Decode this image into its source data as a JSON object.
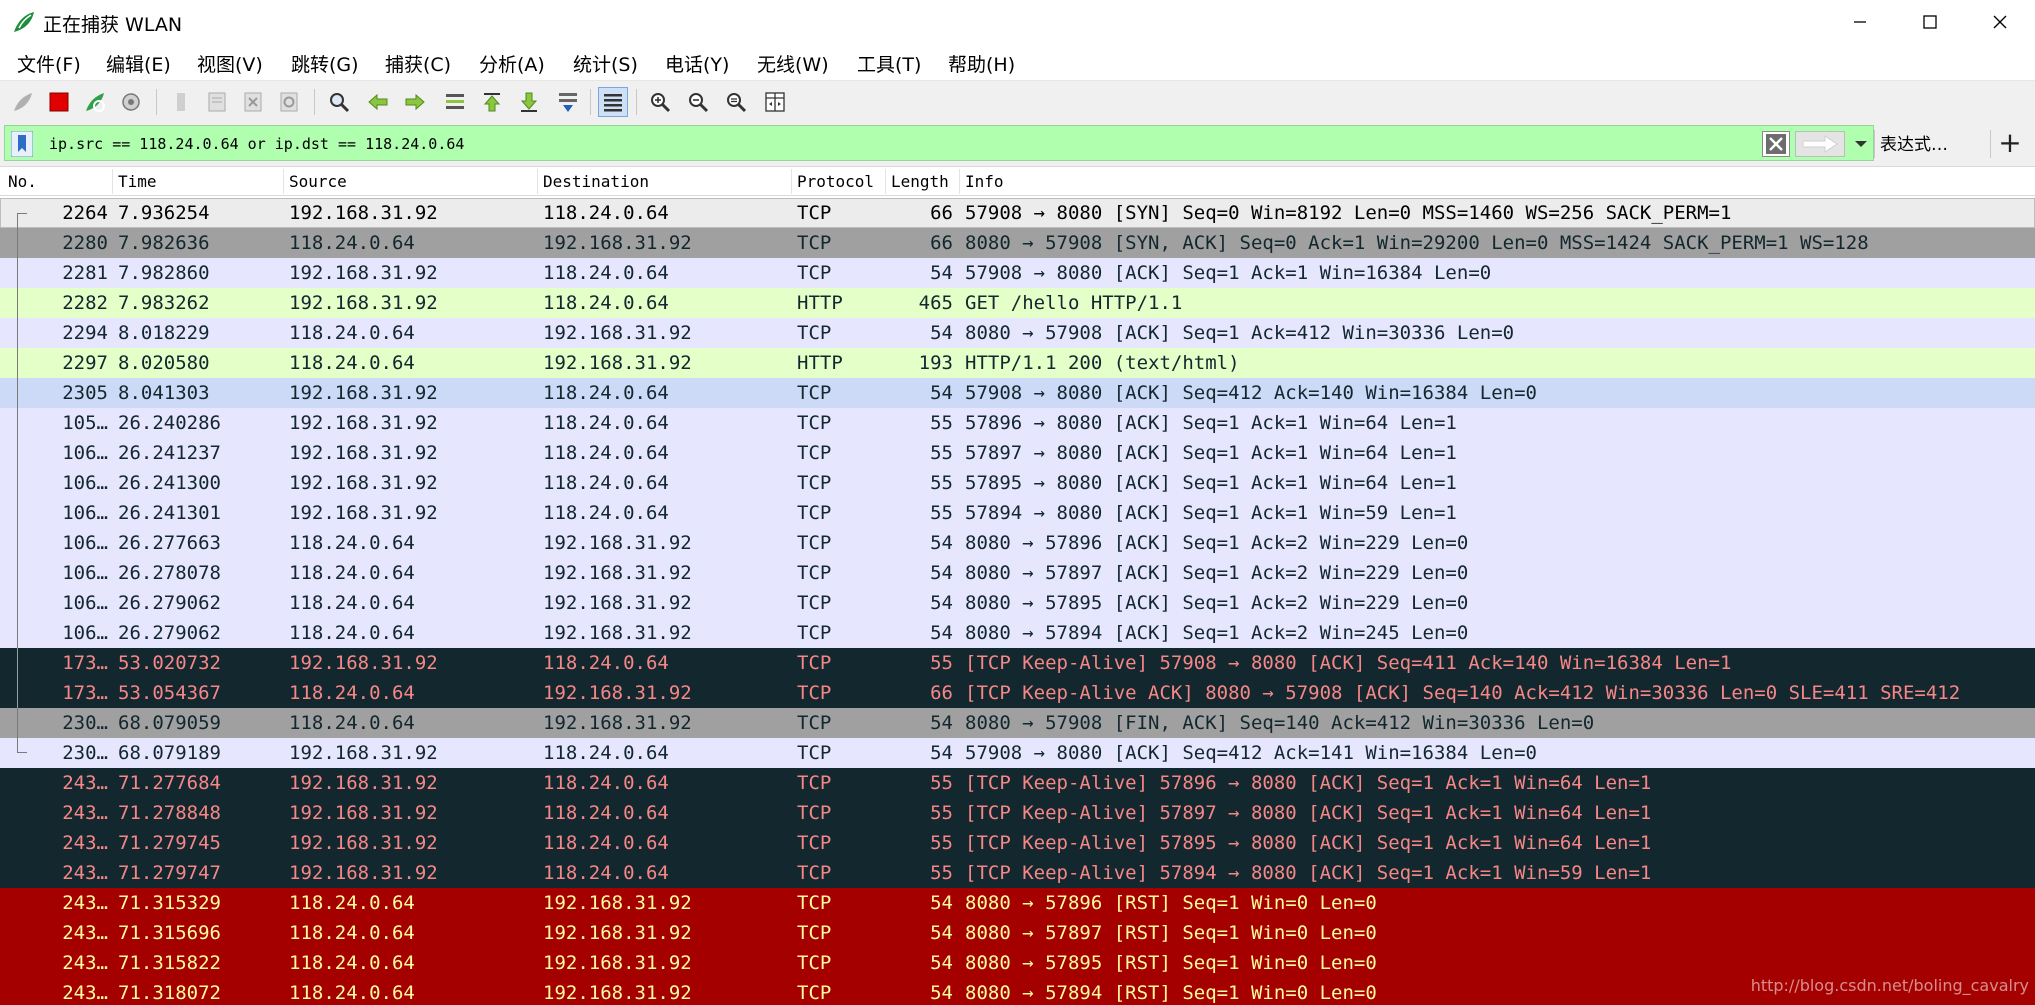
{
  "window": {
    "title": "正在捕获 WLAN",
    "minimize": "—",
    "maximize": "☐",
    "close": "✕"
  },
  "menu": [
    "文件(F)",
    "编辑(E)",
    "视图(V)",
    "跳转(G)",
    "捕获(C)",
    "分析(A)",
    "统计(S)",
    "电话(Y)",
    "无线(W)",
    "工具(T)",
    "帮助(H)"
  ],
  "filter": {
    "value": "ip.src == 118.24.0.64 or ip.dst == 118.24.0.64",
    "expression_label": "表达式…",
    "add_label": "+",
    "color": "#afffaf"
  },
  "columns": [
    "No.",
    "Time",
    "Source",
    "Destination",
    "Protocol",
    "Length",
    "Info"
  ],
  "palette": {
    "lav": {
      "bg": "#e7e6ff",
      "fg": "#12272e"
    },
    "grey": {
      "bg": "#a0a0a0",
      "fg": "#12272e"
    },
    "http": {
      "bg": "#e4ffc7",
      "fg": "#12272e"
    },
    "sel": {
      "bg": "#ccdaf7",
      "fg": "#12272e"
    },
    "dark": {
      "bg": "#12272e",
      "fg": "#f78787"
    },
    "red": {
      "bg": "#a40000",
      "fg": "#fffc9c"
    },
    "first": {
      "bg": "#ececec",
      "fg": "#000000"
    }
  },
  "packets": [
    {
      "no": "2264",
      "time": "7.936254",
      "src": "192.168.31.92",
      "dst": "118.24.0.64",
      "proto": "TCP",
      "len": "66",
      "info": "57908 → 8080 [SYN] Seq=0 Win=8192 Len=0 MSS=1460 WS=256 SACK_PERM=1",
      "style": "first"
    },
    {
      "no": "2280",
      "time": "7.982636",
      "src": "118.24.0.64",
      "dst": "192.168.31.92",
      "proto": "TCP",
      "len": "66",
      "info": "8080 → 57908 [SYN, ACK] Seq=0 Ack=1 Win=29200 Len=0 MSS=1424 SACK_PERM=1 WS=128",
      "style": "grey"
    },
    {
      "no": "2281",
      "time": "7.982860",
      "src": "192.168.31.92",
      "dst": "118.24.0.64",
      "proto": "TCP",
      "len": "54",
      "info": "57908 → 8080 [ACK] Seq=1 Ack=1 Win=16384 Len=0",
      "style": "lav"
    },
    {
      "no": "2282",
      "time": "7.983262",
      "src": "192.168.31.92",
      "dst": "118.24.0.64",
      "proto": "HTTP",
      "len": "465",
      "info": "GET /hello HTTP/1.1",
      "style": "http"
    },
    {
      "no": "2294",
      "time": "8.018229",
      "src": "118.24.0.64",
      "dst": "192.168.31.92",
      "proto": "TCP",
      "len": "54",
      "info": "8080 → 57908 [ACK] Seq=1 Ack=412 Win=30336 Len=0",
      "style": "lav"
    },
    {
      "no": "2297",
      "time": "8.020580",
      "src": "118.24.0.64",
      "dst": "192.168.31.92",
      "proto": "HTTP",
      "len": "193",
      "info": "HTTP/1.1 200   (text/html)",
      "style": "http"
    },
    {
      "no": "2305",
      "time": "8.041303",
      "src": "192.168.31.92",
      "dst": "118.24.0.64",
      "proto": "TCP",
      "len": "54",
      "info": "57908 → 8080 [ACK] Seq=412 Ack=140 Win=16384 Len=0",
      "style": "sel"
    },
    {
      "no": "105…",
      "time": "26.240286",
      "src": "192.168.31.92",
      "dst": "118.24.0.64",
      "proto": "TCP",
      "len": "55",
      "info": "57896 → 8080 [ACK] Seq=1 Ack=1 Win=64 Len=1",
      "style": "lav"
    },
    {
      "no": "106…",
      "time": "26.241237",
      "src": "192.168.31.92",
      "dst": "118.24.0.64",
      "proto": "TCP",
      "len": "55",
      "info": "57897 → 8080 [ACK] Seq=1 Ack=1 Win=64 Len=1",
      "style": "lav"
    },
    {
      "no": "106…",
      "time": "26.241300",
      "src": "192.168.31.92",
      "dst": "118.24.0.64",
      "proto": "TCP",
      "len": "55",
      "info": "57895 → 8080 [ACK] Seq=1 Ack=1 Win=64 Len=1",
      "style": "lav"
    },
    {
      "no": "106…",
      "time": "26.241301",
      "src": "192.168.31.92",
      "dst": "118.24.0.64",
      "proto": "TCP",
      "len": "55",
      "info": "57894 → 8080 [ACK] Seq=1 Ack=1 Win=59 Len=1",
      "style": "lav"
    },
    {
      "no": "106…",
      "time": "26.277663",
      "src": "118.24.0.64",
      "dst": "192.168.31.92",
      "proto": "TCP",
      "len": "54",
      "info": "8080 → 57896 [ACK] Seq=1 Ack=2 Win=229 Len=0",
      "style": "lav"
    },
    {
      "no": "106…",
      "time": "26.278078",
      "src": "118.24.0.64",
      "dst": "192.168.31.92",
      "proto": "TCP",
      "len": "54",
      "info": "8080 → 57897 [ACK] Seq=1 Ack=2 Win=229 Len=0",
      "style": "lav"
    },
    {
      "no": "106…",
      "time": "26.279062",
      "src": "118.24.0.64",
      "dst": "192.168.31.92",
      "proto": "TCP",
      "len": "54",
      "info": "8080 → 57895 [ACK] Seq=1 Ack=2 Win=229 Len=0",
      "style": "lav"
    },
    {
      "no": "106…",
      "time": "26.279062",
      "src": "118.24.0.64",
      "dst": "192.168.31.92",
      "proto": "TCP",
      "len": "54",
      "info": "8080 → 57894 [ACK] Seq=1 Ack=2 Win=245 Len=0",
      "style": "lav"
    },
    {
      "no": "173…",
      "time": "53.020732",
      "src": "192.168.31.92",
      "dst": "118.24.0.64",
      "proto": "TCP",
      "len": "55",
      "info": "[TCP Keep-Alive] 57908 → 8080 [ACK] Seq=411 Ack=140 Win=16384 Len=1",
      "style": "dark"
    },
    {
      "no": "173…",
      "time": "53.054367",
      "src": "118.24.0.64",
      "dst": "192.168.31.92",
      "proto": "TCP",
      "len": "66",
      "info": "[TCP Keep-Alive ACK] 8080 → 57908 [ACK] Seq=140 Ack=412 Win=30336 Len=0 SLE=411 SRE=412",
      "style": "dark"
    },
    {
      "no": "230…",
      "time": "68.079059",
      "src": "118.24.0.64",
      "dst": "192.168.31.92",
      "proto": "TCP",
      "len": "54",
      "info": "8080 → 57908 [FIN, ACK] Seq=140 Ack=412 Win=30336 Len=0",
      "style": "grey"
    },
    {
      "no": "230…",
      "time": "68.079189",
      "src": "192.168.31.92",
      "dst": "118.24.0.64",
      "proto": "TCP",
      "len": "54",
      "info": "57908 → 8080 [ACK] Seq=412 Ack=141 Win=16384 Len=0",
      "style": "lav"
    },
    {
      "no": "243…",
      "time": "71.277684",
      "src": "192.168.31.92",
      "dst": "118.24.0.64",
      "proto": "TCP",
      "len": "55",
      "info": "[TCP Keep-Alive] 57896 → 8080 [ACK] Seq=1 Ack=1 Win=64 Len=1",
      "style": "dark"
    },
    {
      "no": "243…",
      "time": "71.278848",
      "src": "192.168.31.92",
      "dst": "118.24.0.64",
      "proto": "TCP",
      "len": "55",
      "info": "[TCP Keep-Alive] 57897 → 8080 [ACK] Seq=1 Ack=1 Win=64 Len=1",
      "style": "dark"
    },
    {
      "no": "243…",
      "time": "71.279745",
      "src": "192.168.31.92",
      "dst": "118.24.0.64",
      "proto": "TCP",
      "len": "55",
      "info": "[TCP Keep-Alive] 57895 → 8080 [ACK] Seq=1 Ack=1 Win=64 Len=1",
      "style": "dark"
    },
    {
      "no": "243…",
      "time": "71.279747",
      "src": "192.168.31.92",
      "dst": "118.24.0.64",
      "proto": "TCP",
      "len": "55",
      "info": "[TCP Keep-Alive] 57894 → 8080 [ACK] Seq=1 Ack=1 Win=59 Len=1",
      "style": "dark"
    },
    {
      "no": "243…",
      "time": "71.315329",
      "src": "118.24.0.64",
      "dst": "192.168.31.92",
      "proto": "TCP",
      "len": "54",
      "info": "8080 → 57896 [RST] Seq=1 Win=0 Len=0",
      "style": "red"
    },
    {
      "no": "243…",
      "time": "71.315696",
      "src": "118.24.0.64",
      "dst": "192.168.31.92",
      "proto": "TCP",
      "len": "54",
      "info": "8080 → 57897 [RST] Seq=1 Win=0 Len=0",
      "style": "red"
    },
    {
      "no": "243…",
      "time": "71.315822",
      "src": "118.24.0.64",
      "dst": "192.168.31.92",
      "proto": "TCP",
      "len": "54",
      "info": "8080 → 57895 [RST] Seq=1 Win=0 Len=0",
      "style": "red"
    },
    {
      "no": "243…",
      "time": "71.318072",
      "src": "118.24.0.64",
      "dst": "192.168.31.92",
      "proto": "TCP",
      "len": "54",
      "info": "8080 → 57894 [RST] Seq=1 Win=0 Len=0",
      "style": "red"
    }
  ],
  "watermark": "http://blog.csdn.net/boling_cavalry"
}
